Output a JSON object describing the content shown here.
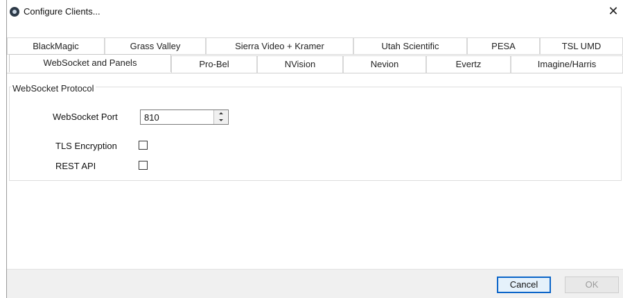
{
  "window": {
    "title": "Configure Clients...",
    "close_glyph": "✕"
  },
  "tabs": {
    "row1": [
      {
        "label": "BlackMagic"
      },
      {
        "label": "Grass Valley"
      },
      {
        "label": "Sierra Video + Kramer"
      },
      {
        "label": "Utah Scientific"
      },
      {
        "label": "PESA"
      },
      {
        "label": "TSL UMD"
      }
    ],
    "row2": [
      {
        "label": "WebSocket and Panels"
      },
      {
        "label": "Pro-Bel"
      },
      {
        "label": "NVision"
      },
      {
        "label": "Nevion"
      },
      {
        "label": "Evertz"
      },
      {
        "label": "Imagine/Harris"
      }
    ],
    "active": "WebSocket and Panels"
  },
  "websocket_group": {
    "title": "WebSocket Protocol",
    "port_label": "WebSocket Port",
    "port_value": "810",
    "tls_label": "TLS Encryption",
    "tls_checked": false,
    "rest_label": "REST API",
    "rest_checked": false
  },
  "footer": {
    "cancel_label": "Cancel",
    "ok_label": "OK"
  },
  "colors": {
    "focus_border": "#0a64c8",
    "disabled_text": "#9a9a9a",
    "footer_bg": "#f0f0f0"
  }
}
